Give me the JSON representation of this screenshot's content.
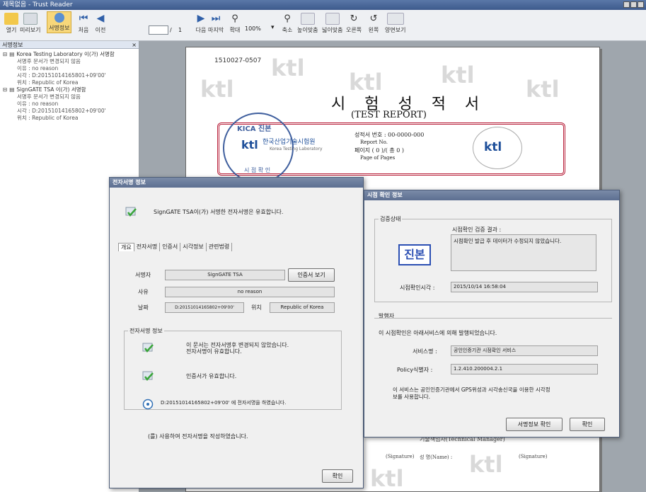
{
  "app": {
    "title": "제목없음 - Trust Reader"
  },
  "toolbar": {
    "open": "열기",
    "preview": "미리보기",
    "sign_info": "서명정보",
    "first": "처음",
    "prev": "이전",
    "page_sep": "/",
    "page_total": "1",
    "next": "다음",
    "last": "마지막",
    "zoom_in": "확대",
    "zoom_level": "100%",
    "zoom_out": "축소",
    "fit_height": "높이맞춤",
    "fit_width": "넓이맞춤",
    "rotate_right": "오른쪽",
    "rotate_left": "왼쪽",
    "two_page": "양면보기"
  },
  "panel": {
    "title": "서명정보",
    "close": "×",
    "items": [
      {
        "label": "Korea Testing Laboratory 이(가) 서명함",
        "lines": [
          "서명후 문서가 변경되지 않음",
          "이유 : no reason",
          "시각 : D:20151014165801+09'00'",
          "위치 : Republic of Korea"
        ]
      },
      {
        "label": "SignGATE TSA 이(가) 서명함",
        "lines": [
          "서명후 문서가 변경되지 않음",
          "이유 : no reason",
          "시각 : D:20151014165802+09'00'",
          "위치 : Republic of Korea"
        ]
      }
    ]
  },
  "document": {
    "doc_no": "1510027-0507",
    "title": "시 험 성 적 서",
    "subtitle": "(TEST REPORT)",
    "watermark": "ktl",
    "stamp_top": "KICA 진본",
    "stamp_bottom": "시 점 확 인",
    "org_name_ko": "한국산업기술시험원",
    "org_name_en": "Korea Testing Laboratory",
    "cert_no_label": "성적서 번호 : 00-0000-000",
    "report_no": "Report No.",
    "pages_label": "페이지 ( 0 )/( 총 0 )",
    "page_of_pages": "Page of Pages",
    "badge": "ktl",
    "tech_manager": "기술책임자(Technical Manager)",
    "signature_left": "(Signature)",
    "name_label": "성  명(Name) :",
    "signature_right": "(Signature)"
  },
  "sig_dialog": {
    "title": "전자서명 정보",
    "header_msg": "SignGATE TSA이(가) 서명한 전자서명은 유효합니다.",
    "tabs": [
      "개요",
      "전자서명",
      "인증서",
      "시각정보",
      "관련법령"
    ],
    "signer_label": "서명자",
    "signer_value": "SignGATE TSA",
    "view_cert": "인증서 보기",
    "reason_label": "사유",
    "reason_value": "no reason",
    "date_label": "날짜",
    "date_value": "D:20151014165802+09'00'",
    "location_label": "위치",
    "location_value": "Republic of Korea",
    "group_label": "전자서명 정보",
    "status1a": "이 문서는 전자서명후 변경되지 않았습니다.",
    "status1b": "전자서명이 유효합니다.",
    "status2": "인증서가 유효합니다.",
    "status3": "D:20151014165802+09'00' 에 전자서명을 하였습니다.",
    "footer_msg": "(를) 사용하여 전자서명을 작성하였습니다.",
    "ok": "확인"
  },
  "ts_dialog": {
    "title": "시점 확인 정보",
    "verify_group": "검증상태",
    "result_label": "시점확인 검증 결과 :",
    "result_text": "시점확인 발급 후 데이터가 수정되지 않았습니다.",
    "seal": "진본",
    "time_label": "시점확인시각 :",
    "time_value": "2015/10/14 16:58:04",
    "issuer_group": "발행자",
    "issuer_msg": "이 시점확인은 아래서비스에 의해 발행되었습니다.",
    "service_label": "서비스명 :",
    "service_value": "공인인증기관 시점확인 서비스",
    "policy_label": "Policy식별자 :",
    "policy_value": "1.2.410.200004.2.1",
    "gps_msg_a": "이 서비스는 공인인증기관에서 GPS위성과 시각송신국을 이용한 시각정",
    "gps_msg_b": "보를 사용합니다.",
    "btn_sig_info": "서명정보 확인",
    "btn_ok": "확인"
  }
}
